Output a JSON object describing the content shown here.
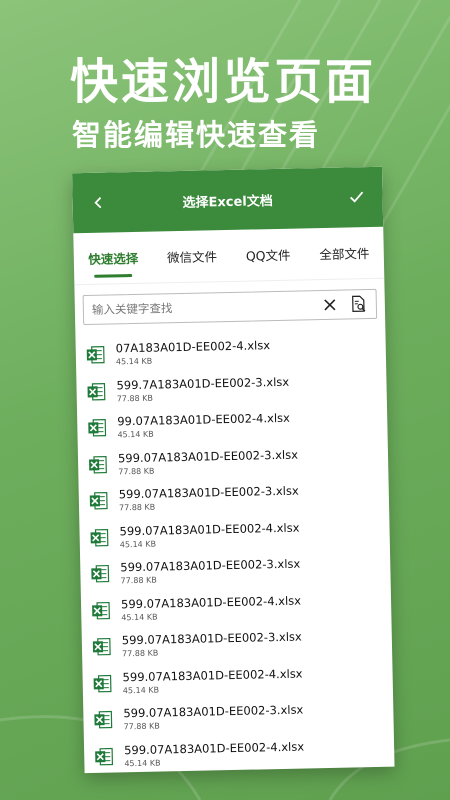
{
  "promo": {
    "headline": "快速浏览页面",
    "subline": "智能编辑快速查看"
  },
  "appbar": {
    "title": "选择Excel文档"
  },
  "tabs": [
    {
      "label": "快速选择",
      "active": true
    },
    {
      "label": "微信文件",
      "active": false
    },
    {
      "label": "QQ文件",
      "active": false
    },
    {
      "label": "全部文件",
      "active": false
    }
  ],
  "search": {
    "placeholder": "输入关键字查找",
    "value": ""
  },
  "files": [
    {
      "name": "07A183A01D-EE002-4.xlsx",
      "size": "45.14 KB"
    },
    {
      "name": "599.7A183A01D-EE002-3.xlsx",
      "size": "77.88 KB"
    },
    {
      "name": "99.07A183A01D-EE002-4.xlsx",
      "size": "45.14 KB"
    },
    {
      "name": "599.07A183A01D-EE002-3.xlsx",
      "size": "77.88 KB"
    },
    {
      "name": "599.07A183A01D-EE002-3.xlsx",
      "size": "77.88 KB"
    },
    {
      "name": "599.07A183A01D-EE002-4.xlsx",
      "size": "45.14 KB"
    },
    {
      "name": "599.07A183A01D-EE002-3.xlsx",
      "size": "77.88 KB"
    },
    {
      "name": "599.07A183A01D-EE002-4.xlsx",
      "size": "45.14 KB"
    },
    {
      "name": "599.07A183A01D-EE002-3.xlsx",
      "size": "77.88 KB"
    },
    {
      "name": "599.07A183A01D-EE002-4.xlsx",
      "size": "45.14 KB"
    },
    {
      "name": "599.07A183A01D-EE002-3.xlsx",
      "size": "77.88 KB"
    },
    {
      "name": "599.07A183A01D-EE002-4.xlsx",
      "size": "45.14 KB"
    }
  ],
  "icons": {
    "back": "chevron-left-icon",
    "confirm": "check-icon",
    "clear": "close-icon",
    "search": "document-search-icon",
    "file": "excel-file-icon"
  },
  "colors": {
    "background": "#6dae5d",
    "appbar": "#3c8a3c",
    "accent": "#2f7d2f",
    "excel": "#1f7a3a"
  }
}
